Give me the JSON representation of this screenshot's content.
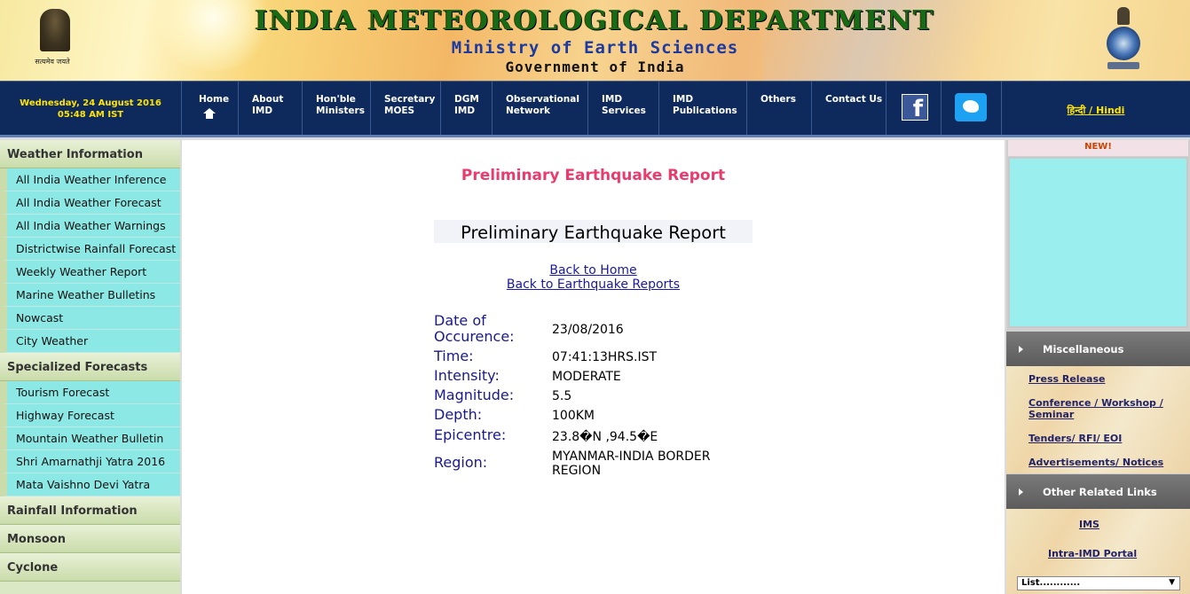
{
  "header": {
    "title": "INDIA METEOROLOGICAL DEPARTMENT",
    "subtitle": "Ministry of Earth Sciences",
    "subtitle2": "Government of India",
    "motto": "सत्यमेव जयते"
  },
  "nav": {
    "date": "Wednesday, 24 August 2016",
    "time": "05:48 AM IST",
    "items": [
      {
        "l1": "Home",
        "l2": ""
      },
      {
        "l1": "About",
        "l2": "IMD"
      },
      {
        "l1": "Hon'ble",
        "l2": "Ministers"
      },
      {
        "l1": "Secretary",
        "l2": "MOES"
      },
      {
        "l1": "DGM",
        "l2": "IMD"
      },
      {
        "l1": "Observational",
        "l2": "Network"
      },
      {
        "l1": "IMD",
        "l2": "Services"
      },
      {
        "l1": "IMD",
        "l2": "Publications"
      },
      {
        "l1": "Others",
        "l2": ""
      },
      {
        "l1": "Contact Us",
        "l2": ""
      }
    ],
    "facebook_icon": "f",
    "hindi": "हिन्दी / Hindi"
  },
  "sidebar": {
    "weather_info": "Weather Information",
    "weather_items": [
      "All India Weather Inference",
      "All India Weather Forecast",
      "All India Weather Warnings",
      "Districtwise Rainfall Forecast",
      "Weekly Weather Report",
      "Marine Weather Bulletins",
      "Nowcast",
      "City Weather"
    ],
    "specialized": "Specialized Forecasts",
    "specialized_items": [
      "Tourism Forecast",
      "Highway Forecast",
      "Mountain Weather Bulletin",
      "Shri Amarnathji Yatra 2016",
      "Mata Vaishno Devi Yatra"
    ],
    "rainfall": "Rainfall Information",
    "monsoon": "Monsoon",
    "cyclone": "Cyclone"
  },
  "main": {
    "page_title": "Preliminary Earthquake Report",
    "card_title": "Preliminary Earthquake Report",
    "back_home": "Back to Home",
    "back_reports": "Back to Earthquake Reports",
    "report": {
      "date_label_1": "Date of",
      "date_label_2": "Occurence:",
      "date_value": "23/08/2016",
      "time_label": "Time:",
      "time_value": "07:41:13HRS.IST",
      "intensity_label": "Intensity:",
      "intensity_value": "MODERATE",
      "magnitude_label": "Magnitude:",
      "magnitude_value": "5.5",
      "depth_label": "Depth:",
      "depth_value": "100KM",
      "epicentre_label": "Epicentre:",
      "epicentre_value": "23.8�N ,94.5�E",
      "region_label": "Region:",
      "region_value_1": "MYANMAR-INDIA BORDER",
      "region_value_2": "REGION"
    }
  },
  "right": {
    "new_badge": "NEW!",
    "misc": "Miscellaneous",
    "misc_links": [
      "Press Release",
      "Conference / Workshop /",
      "Seminar",
      "Tenders/ RFI/ EOI",
      "Advertisements/ Notices"
    ],
    "other": "Other Related Links",
    "other_links": [
      "IMS",
      "Intra-IMD Portal"
    ],
    "select": "List............"
  }
}
